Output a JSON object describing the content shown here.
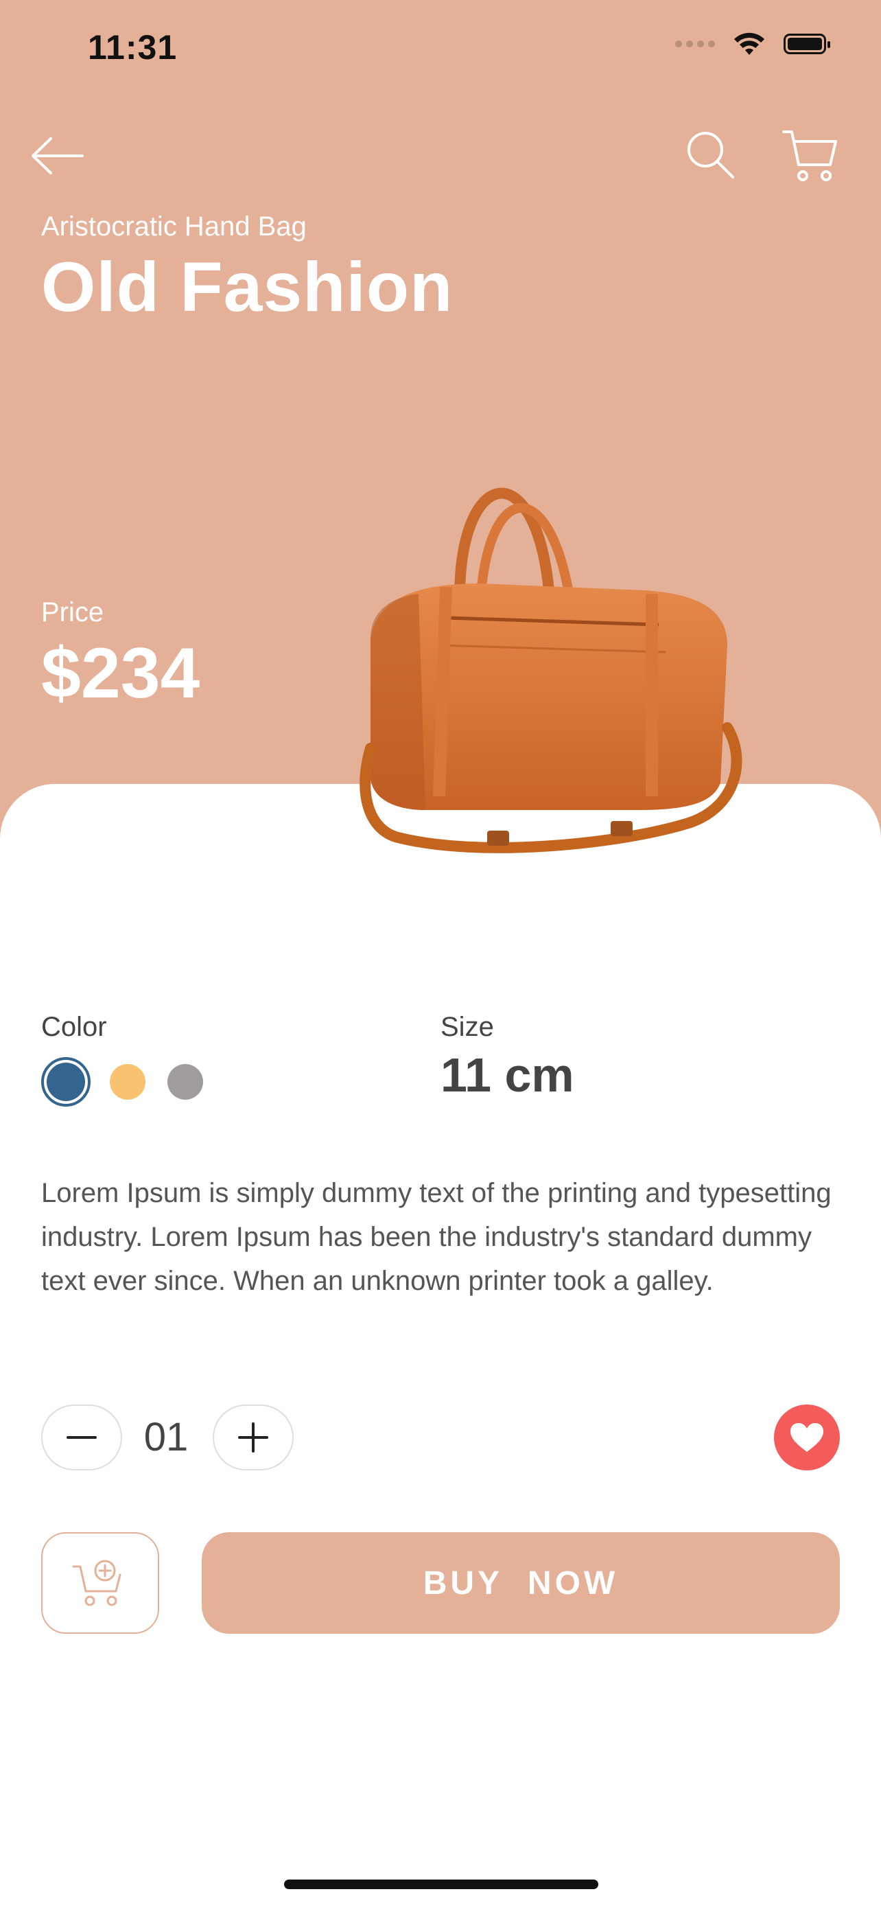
{
  "status_bar": {
    "time": "11:31"
  },
  "colors": {
    "hero_background": "#E4B198",
    "favorite": "#F45B5B"
  },
  "icons": {
    "back": "arrow-left-icon",
    "search": "search-icon",
    "cart": "cart-icon",
    "add_to_cart": "cart-plus-icon",
    "favorite": "heart-icon"
  },
  "product": {
    "category": "Aristocratic Hand Bag",
    "name": "Old Fashion",
    "price_label": "Price",
    "price": "$234"
  },
  "options": {
    "color_label": "Color",
    "colors": [
      "#33658f",
      "#F8C271",
      "#A09C9D"
    ],
    "selected_color": "#33658f",
    "size_label": "Size",
    "size_value": "11 cm"
  },
  "description": "Lorem Ipsum is simply dummy text of the printing and typesetting industry. Lorem Ipsum has been the industry's standard dummy text ever since. When an unknown printer took a galley.",
  "quantity": {
    "value": "01"
  },
  "actions": {
    "buy_label": "BUY  NOW"
  }
}
